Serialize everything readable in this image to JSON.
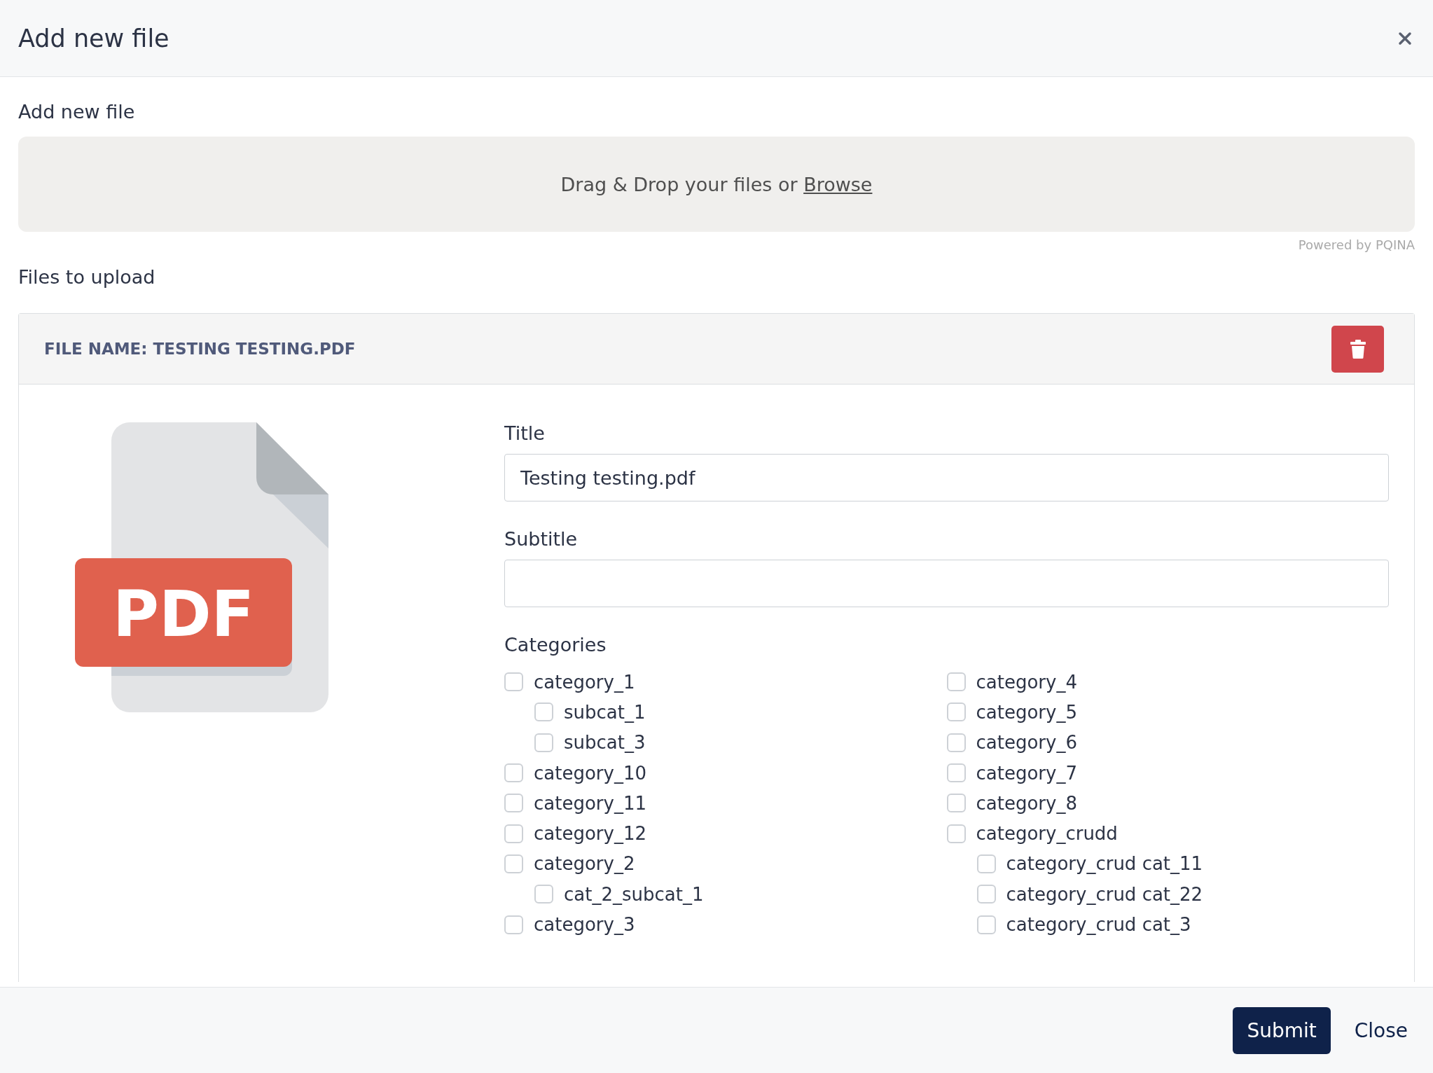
{
  "dialog": {
    "title": "Add new file"
  },
  "upload": {
    "label": "Add new file",
    "drop_text": "Drag & Drop your files or",
    "browse_link": "Browse",
    "credit": "Powered by PQINA"
  },
  "files_label": "Files to upload",
  "file": {
    "header": "FILE NAME: TESTING TESTING.PDF",
    "icon_label": "PDF",
    "fields": [
      {
        "label": "Title",
        "value": "Testing testing.pdf"
      },
      {
        "label": "Subtitle"
      }
    ],
    "categories_label": "Categories",
    "categories": [
      [
        {
          "label": "category_1",
          "checked": false,
          "children": [
            {
              "label": "subcat_1",
              "checked": false
            },
            {
              "label": "subcat_3",
              "checked": false
            }
          ]
        },
        {
          "label": "category_10",
          "checked": false
        },
        {
          "label": "category_11",
          "checked": false
        },
        {
          "label": "category_12",
          "checked": false
        },
        {
          "label": "category_2",
          "checked": false,
          "children": [
            {
              "label": "cat_2_subcat_1",
              "checked": false
            }
          ]
        },
        {
          "label": "category_3",
          "checked": false
        }
      ],
      [
        {
          "label": "category_4",
          "checked": false
        },
        {
          "label": "category_5",
          "checked": false
        },
        {
          "label": "category_6",
          "checked": false
        },
        {
          "label": "category_7",
          "checked": false
        },
        {
          "label": "category_8",
          "checked": false
        },
        {
          "label": "category_crudd",
          "checked": false,
          "children": [
            {
              "label": "category_crud cat_11",
              "checked": false
            },
            {
              "label": "category_crud cat_22",
              "checked": false
            },
            {
              "label": "category_crud cat_3",
              "checked": false
            }
          ]
        }
      ]
    ]
  },
  "buttons": {
    "submit": "Submit",
    "close": "Close"
  }
}
